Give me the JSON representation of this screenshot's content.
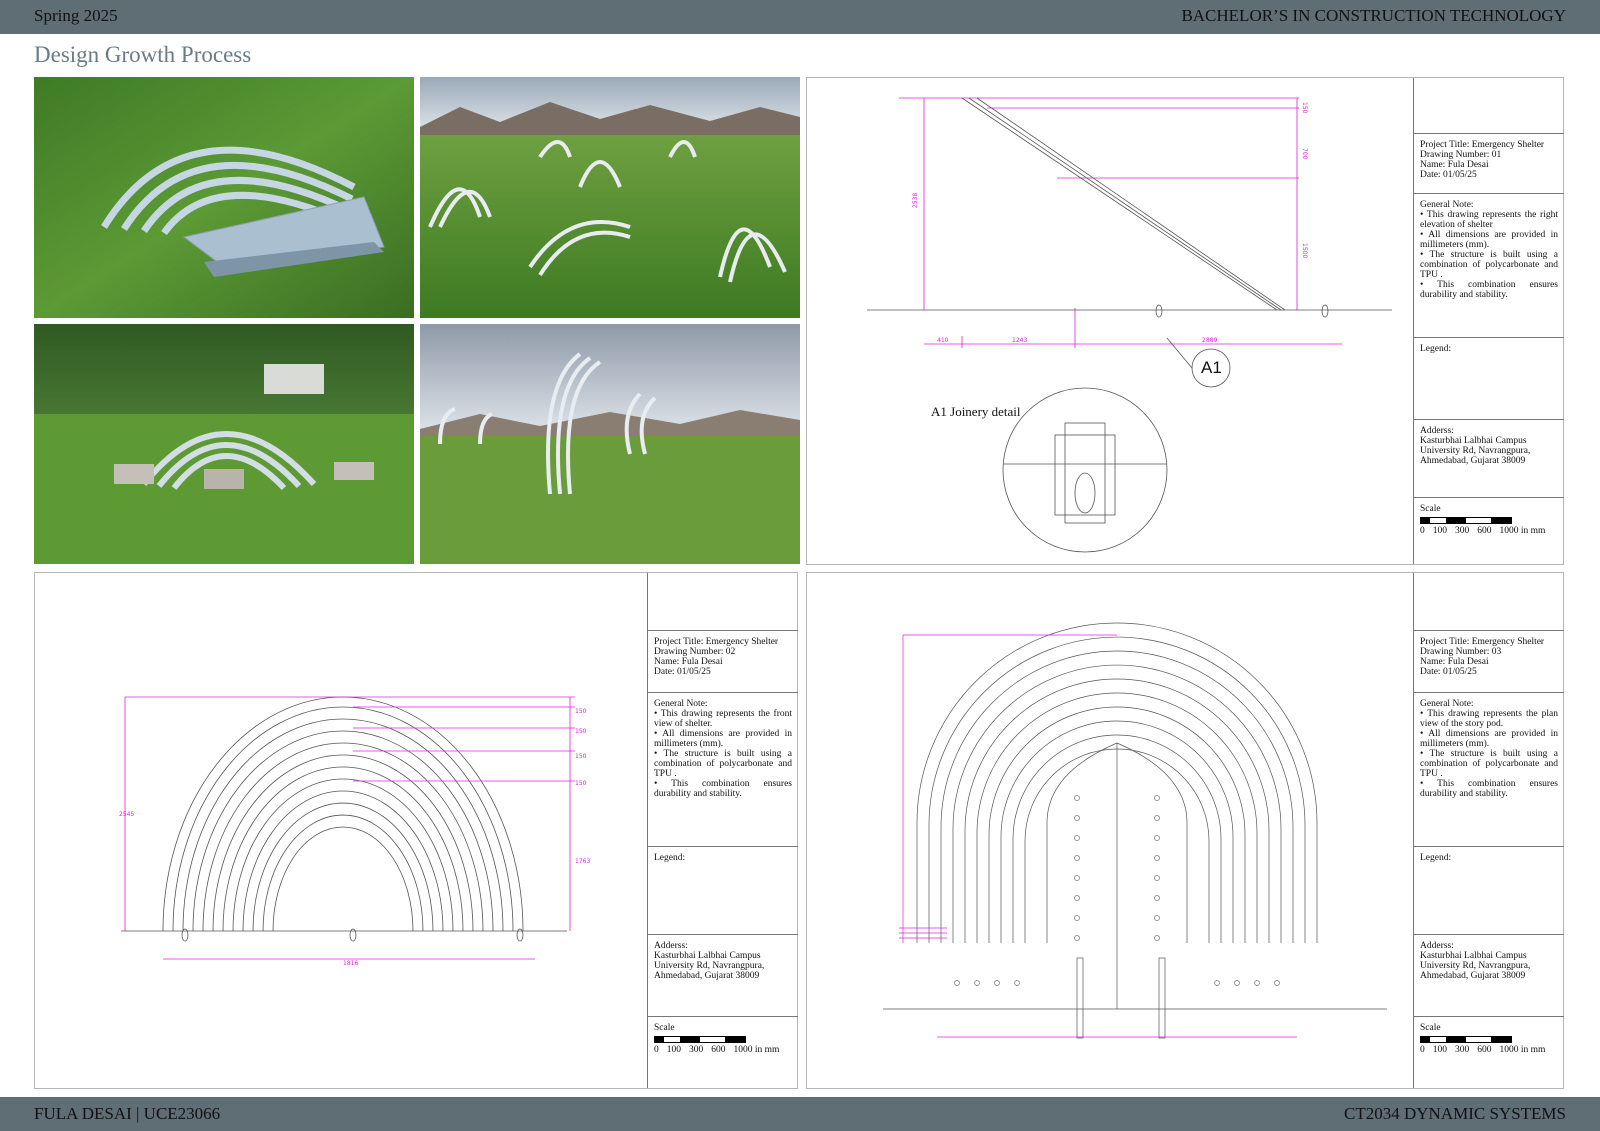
{
  "header": {
    "left": "Spring 2025",
    "right": "BACHELOR’S IN CONSTRUCTION TECHNOLOGY"
  },
  "footer": {
    "left": "FULA DESAI | UCE23066",
    "right": "CT2034 DYNAMIC SYSTEMS"
  },
  "page_title": "Design Growth Process",
  "colors": {
    "bar": "#5f6e74",
    "dimension": "#e020e0",
    "grass": "#4f8a2f",
    "sky": "#a9b6c4"
  },
  "photos": [
    {
      "id": "model-photo-1",
      "subject": "metal arch strip model on grass"
    },
    {
      "id": "render-1",
      "subject": "shelters in mountain meadow render"
    },
    {
      "id": "model-photo-2",
      "subject": "arched shelter model on lawn with trees"
    },
    {
      "id": "render-2",
      "subject": "tall arched strips in cloudy sky render"
    }
  ],
  "drawing1": {
    "joinery_label": "A1 Joinery detail",
    "callout": "A1",
    "dims_bottom": [
      "410",
      "1243",
      "2889"
    ],
    "dims_side": [
      "2538",
      "700",
      "1500",
      "150"
    ],
    "title_block": {
      "project": "Project Title: Emergency Shelter",
      "number": "Drawing Number: 01",
      "name": "Name: Fula Desai",
      "date": "Date: 01/05/25",
      "general_note_label": "General Note:",
      "notes": [
        "•      This drawing represents the right elevation of shelter",
        "•      All dimensions are provided in millimeters (mm).",
        "•      The structure is built using a combination of polycarbonate and TPU .",
        "•      This combination ensures durability and stability."
      ],
      "legend_label": "Legend:",
      "address_label": "Adderss:",
      "address": [
        "Kasturbhai Lalbhai Campus",
        "University Rd, Navrangpura,",
        "Ahmedabad, Gujarat 38009"
      ],
      "scale_label": "Scale",
      "scale_nums": [
        "0",
        "100",
        "300",
        "600",
        "1000 in mm"
      ]
    }
  },
  "drawing2": {
    "dims_bottom_center": "1816",
    "dim_left": "2545",
    "dims_right": [
      "150",
      "150",
      "150",
      "150",
      "1763"
    ],
    "title_block": {
      "project": "Project Title: Emergency Shelter",
      "number": "Drawing Number: 02",
      "name": "Name: Fula Desai",
      "date": "Date: 01/05/25",
      "general_note_label": "General Note:",
      "notes": [
        "•      This drawing represents the front view of shelter.",
        "•      All dimensions are provided in millimeters (mm).",
        "•      The structure is built using a combination of polycarbonate and TPU .",
        "•      This combination ensures durability and stability."
      ],
      "legend_label": "Legend:",
      "address_label": "Adderss:",
      "address": [
        "Kasturbhai Lalbhai Campus",
        "University Rd, Navrangpura,",
        "Ahmedabad, Gujarat 38009"
      ],
      "scale_label": "Scale",
      "scale_nums": [
        "0",
        "100",
        "300",
        "600",
        "1000 in mm"
      ]
    }
  },
  "drawing3": {
    "title_block": {
      "project": "Project Title: Emergency Shelter",
      "number": "Drawing Number: 03",
      "name": "Name: Fula Desai",
      "date": "Date: 01/05/25",
      "general_note_label": "General Note:",
      "notes": [
        "•      This drawing represents the plan view of the story pod.",
        "•      All dimensions are provided in millimeters (mm).",
        "•      The structure is built using a combination of polycarbonate and TPU .",
        "•      This combination ensures durability and stability."
      ],
      "legend_label": "Legend:",
      "address_label": "Adderss:",
      "address": [
        "Kasturbhai Lalbhai Campus",
        "University Rd, Navrangpura,",
        "Ahmedabad, Gujarat 38009"
      ],
      "scale_label": "Scale",
      "scale_nums": [
        "0",
        "100",
        "300",
        "600",
        "1000 in mm"
      ]
    }
  }
}
